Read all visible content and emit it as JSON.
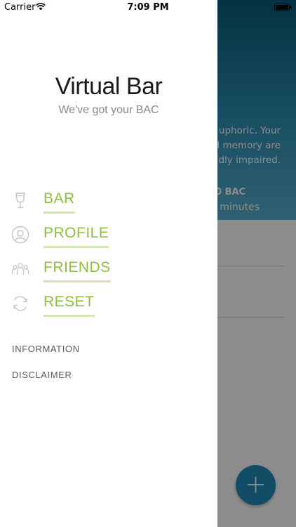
{
  "status_bar": {
    "carrier": "Carrier",
    "time": "7:09 PM",
    "icons": [
      "wifi-icon",
      "battery-icon"
    ]
  },
  "drawer": {
    "title": "Virtual Bar",
    "subtitle": "We've got your BAC",
    "menu_items": [
      {
        "label": "BAR",
        "icon": "wine-glass-icon"
      },
      {
        "label": "PROFILE",
        "icon": "user-icon"
      },
      {
        "label": "FRIENDS",
        "icon": "friends-icon"
      },
      {
        "label": "RESET",
        "icon": "refresh-icon"
      }
    ],
    "links": [
      {
        "label": "INFORMATION"
      },
      {
        "label": "DISCLAIMER"
      }
    ]
  },
  "background": {
    "text_lines": [
      "uphoric. Your",
      "d memory are",
      "ldly impaired."
    ],
    "bac_label": "00 BAC",
    "minutes_label": "0 minutes",
    "fab_label": "+"
  },
  "colors": {
    "accent": "#8dbf3a",
    "accent_underline": "#d4e6b0",
    "header_blue": "#2f90b6",
    "fab_blue": "#1e8db8"
  }
}
